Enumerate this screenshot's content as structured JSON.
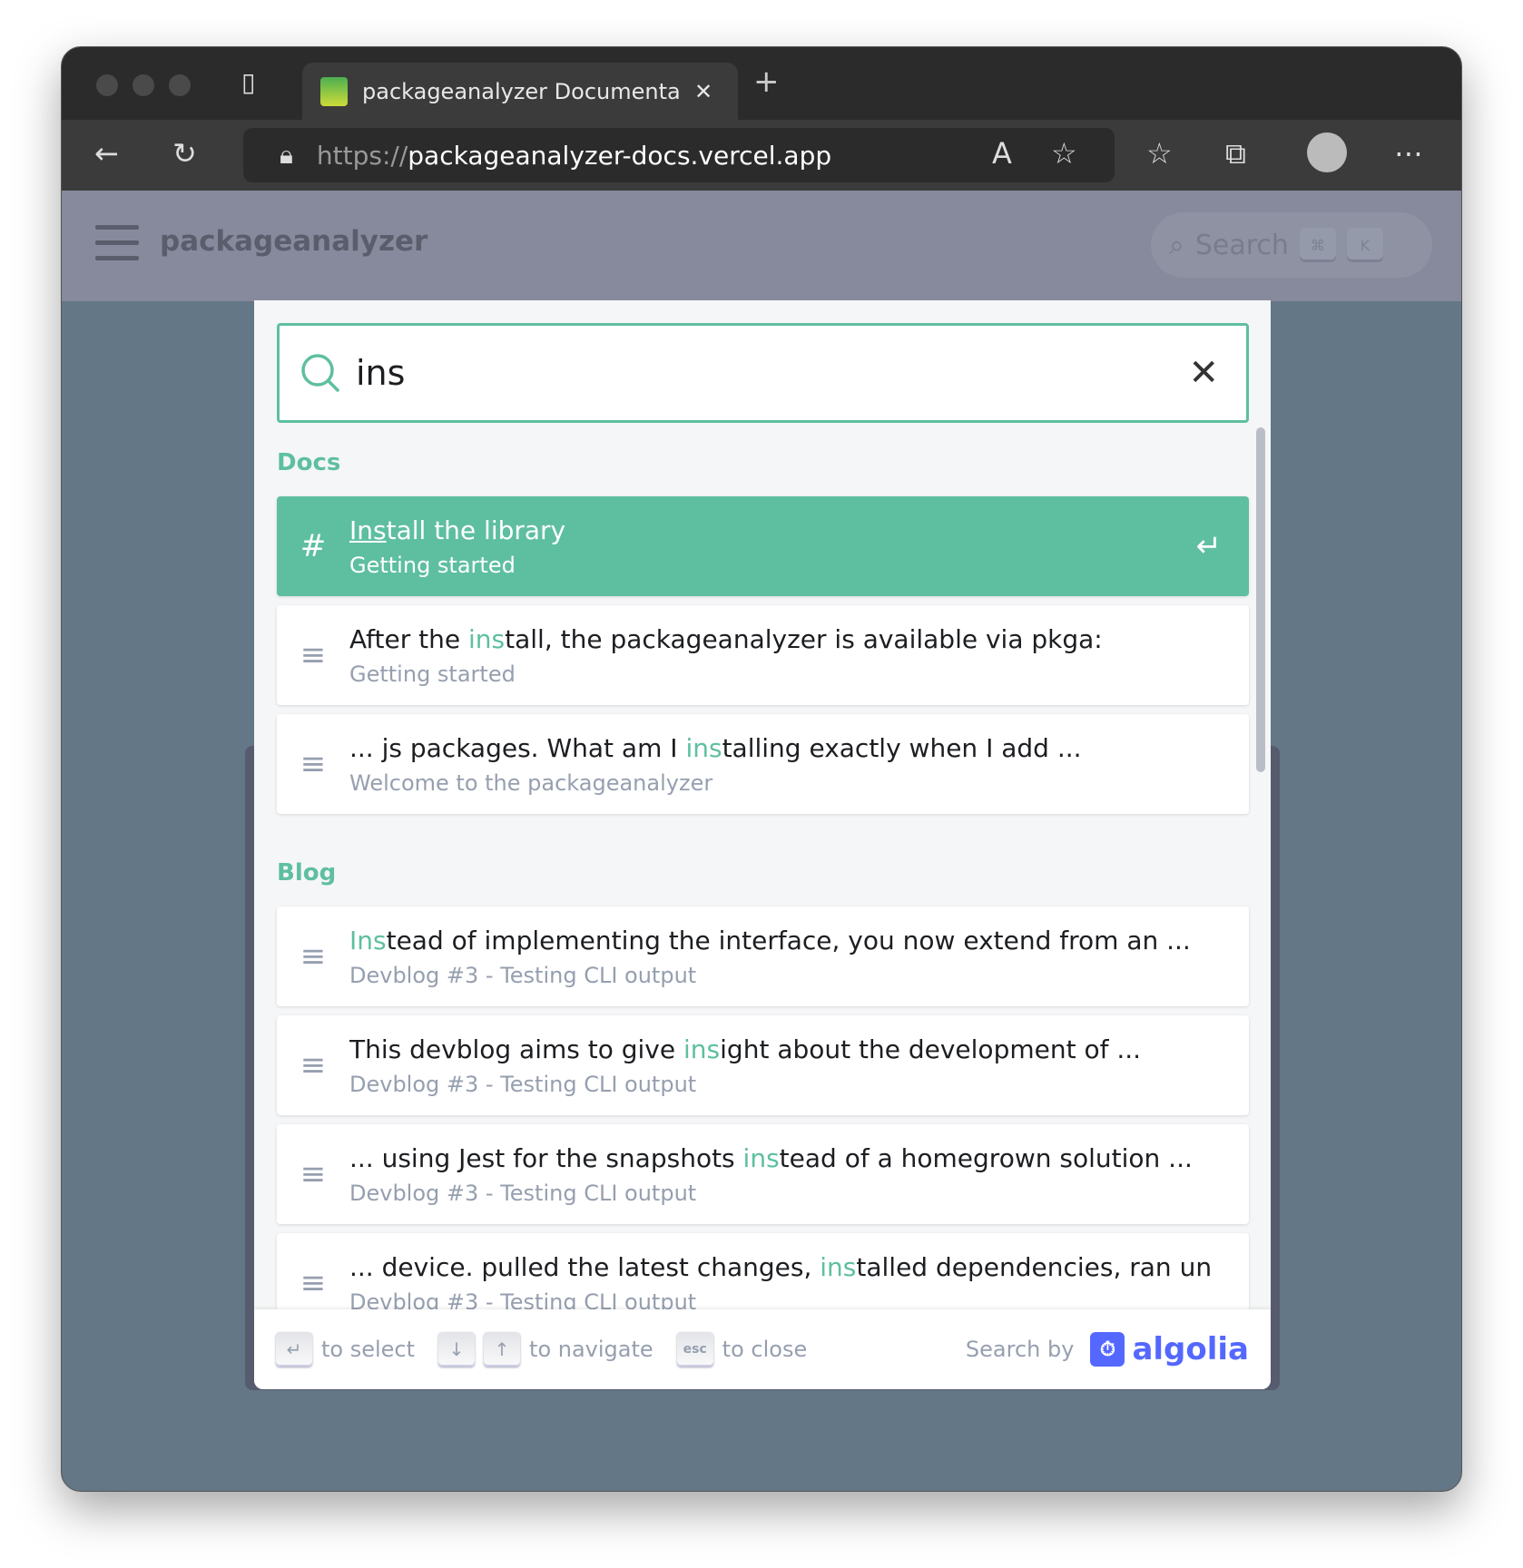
{
  "browser": {
    "tab_title": "packageanalyzer Documentation",
    "url_scheme": "https://",
    "url_host": "packageanalyzer-docs.vercel.app"
  },
  "site": {
    "brand": "packageanalyzer",
    "search_placeholder": "Search",
    "kbd_cmd": "⌘",
    "kbd_k": "K"
  },
  "search": {
    "query": "ins"
  },
  "sections": [
    {
      "label": "Docs",
      "hits": [
        {
          "pre": "",
          "match": "Ins",
          "post": "tall the library",
          "sub": "Getting started",
          "icon": "hash-icon",
          "selected": true
        },
        {
          "pre": "After the ",
          "match": "ins",
          "post": "tall, the packageanalyzer is available via pkga:",
          "sub": "Getting started",
          "icon": "text-icon"
        },
        {
          "pre": "... js packages. What am I ",
          "match": "ins",
          "post": "talling exactly when I add ...",
          "sub": "Welcome to the packageanalyzer",
          "icon": "text-icon"
        }
      ]
    },
    {
      "label": "Blog",
      "hits": [
        {
          "pre": "",
          "match": "Ins",
          "post": "tead of implementing the interface, you now extend from an ...",
          "sub": "Devblog #3 - Testing CLI output",
          "icon": "text-icon"
        },
        {
          "pre": "This devblog aims to give ",
          "match": "ins",
          "post": "ight about the development of ...",
          "sub": "Devblog #3 - Testing CLI output",
          "icon": "text-icon"
        },
        {
          "pre": "... using Jest for the snapshots ",
          "match": "ins",
          "post": "tead of a homegrown solution ...",
          "sub": "Devblog #3 - Testing CLI output",
          "icon": "text-icon"
        },
        {
          "pre": "... device. pulled the latest changes, ",
          "match": "ins",
          "post": "talled dependencies, ran un",
          "sub": "Devblog #3 - Testing CLI output",
          "icon": "text-icon"
        }
      ]
    }
  ],
  "footer": {
    "select": "to select",
    "navigate": "to navigate",
    "esc": "esc",
    "close": "to close",
    "search_by": "Search by",
    "algolia": "algolia"
  },
  "colors": {
    "accent": "#5ebfa0",
    "algolia": "#5468ff"
  }
}
